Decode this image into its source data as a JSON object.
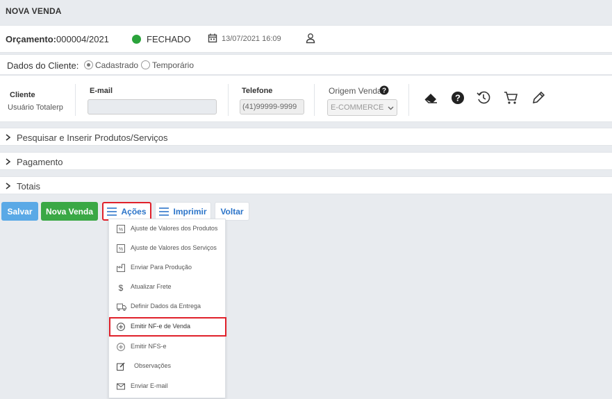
{
  "page": {
    "title": "NOVA VENDA"
  },
  "orcamento": {
    "label": "Orçamento:",
    "value": "000004/2021",
    "status": "FECHADO",
    "status_color": "#2aa33b",
    "date": "13/07/2021 16:09"
  },
  "cliente_tipo": {
    "label": "Dados do Cliente:",
    "options": [
      "Cadastrado",
      "Temporário"
    ],
    "selected": "Cadastrado"
  },
  "cliente": {
    "cliente_label": "Cliente",
    "cliente_value": "Usuário Totalerp",
    "email_label": "E-mail",
    "email_value": "",
    "telefone_label": "Telefone",
    "telefone_value": "(41)99999-9999",
    "origem_label": "Origem Venda",
    "origem_value": "E-COMMERCE"
  },
  "toolbar_icons": [
    "eraser-icon",
    "help-icon",
    "history-icon",
    "cart-icon",
    "pencil-icon"
  ],
  "accordions": [
    {
      "label": "Pesquisar e Inserir Produtos/Serviços"
    },
    {
      "label": "Pagamento"
    },
    {
      "label": "Totais"
    }
  ],
  "buttons": {
    "salvar": "Salvar",
    "nova_venda": "Nova Venda",
    "acoes": "Ações",
    "imprimir": "Imprimir",
    "voltar": "Voltar"
  },
  "acoes_menu": [
    {
      "label": "Ajuste de Valores dos Produtos",
      "icon": "percent-box-icon"
    },
    {
      "label": "Ajuste de Valores dos Serviços",
      "icon": "percent-box-icon"
    },
    {
      "label": "Enviar Para Produção",
      "icon": "factory-icon"
    },
    {
      "label": "Atualizar Frete",
      "icon": "dollar-icon"
    },
    {
      "label": "Definir Dados da Entrega",
      "icon": "truck-icon"
    },
    {
      "label": "Emitir NF-e de Venda",
      "icon": "plus-circle-icon",
      "highlighted": true
    },
    {
      "label": "Emitir NFS-e",
      "icon": "plus-circle-icon"
    },
    {
      "label": "Observações",
      "icon": "edit-icon"
    },
    {
      "label": "Enviar E-mail",
      "icon": "envelope-icon"
    }
  ],
  "colors": {
    "accent_blue": "#5aa9e6",
    "success_green": "#3aa845",
    "link_blue": "#2b74c9",
    "highlight_red": "#e0202a"
  }
}
